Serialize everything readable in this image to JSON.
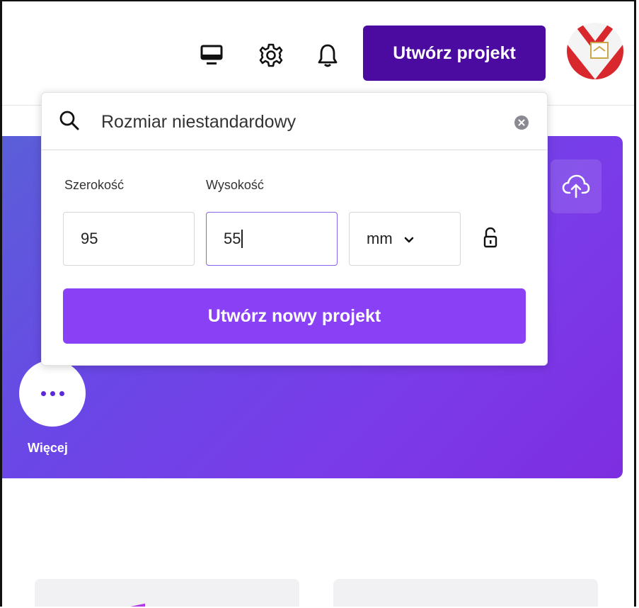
{
  "topbar": {
    "desktop_icon": "desktop-icon",
    "settings_icon": "gear-icon",
    "notifications_icon": "bell-icon",
    "create_button_label": "Utwórz projekt",
    "avatar_icon": "avatar"
  },
  "popover": {
    "search": {
      "value": "Rozmiar niestandardowy",
      "icon": "search-icon",
      "clear_icon": "clear-icon"
    },
    "width_label": "Szerokość",
    "height_label": "Wysokość",
    "width_value": "95",
    "height_value": "55",
    "unit_value": "mm",
    "lock_icon": "unlock-icon",
    "submit_label": "Utwórz nowy projekt"
  },
  "hero": {
    "upload_icon": "cloud-upload-icon",
    "more_label": "Więcej"
  },
  "colors": {
    "brand_dark": "#4b0aa0",
    "brand_primary": "#8a41f5",
    "hero_gradient_start": "#5a5fd8",
    "hero_gradient_end": "#7d2ee0"
  }
}
